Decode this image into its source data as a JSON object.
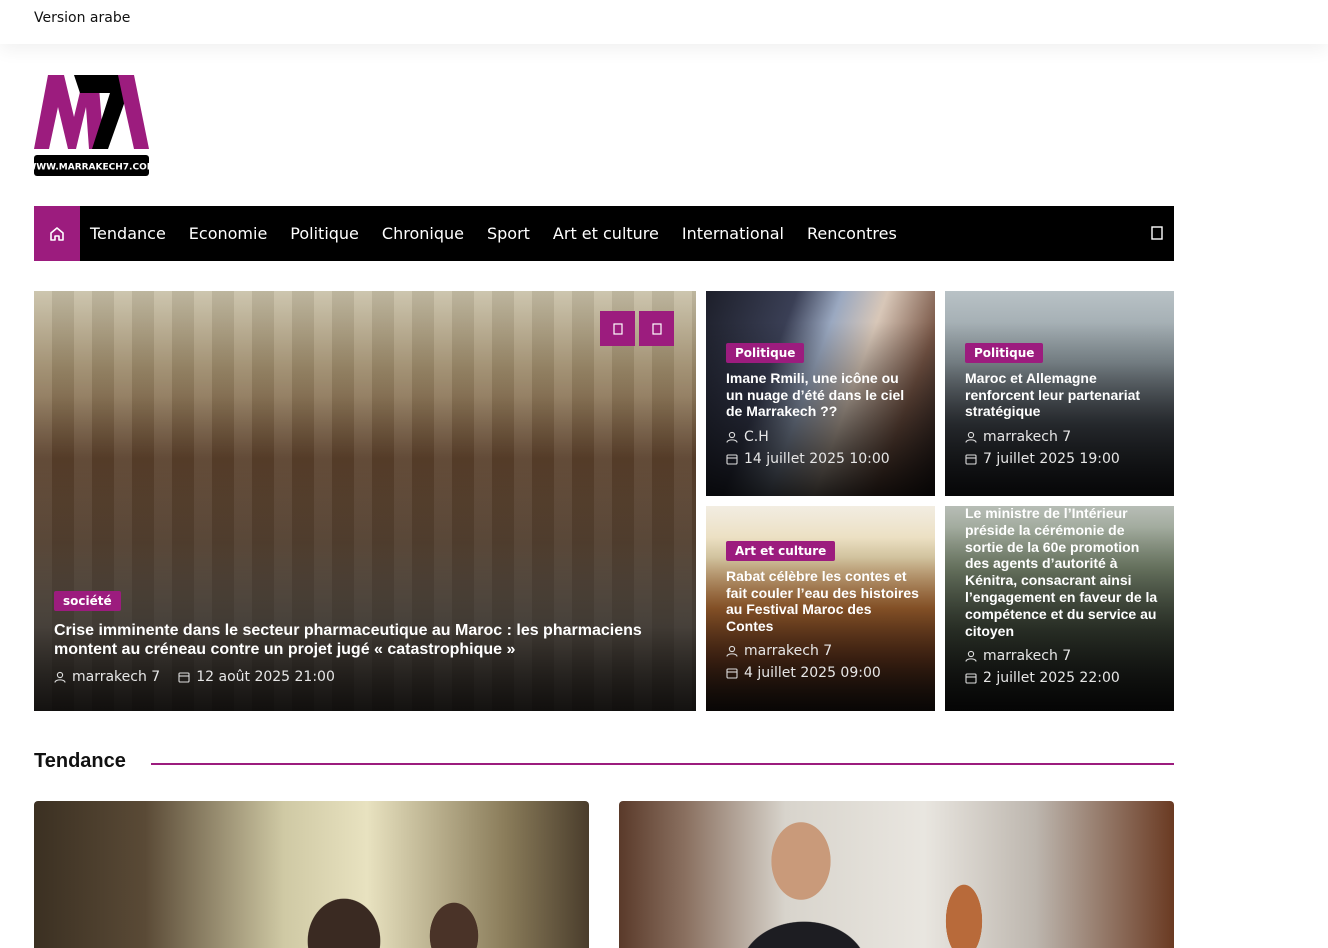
{
  "topbar": {
    "version_link": "Version arabe"
  },
  "logo": {
    "letters": "M7",
    "site": "WWW.MARRAKECH7.COM"
  },
  "nav": {
    "home_icon": "home-icon",
    "items": [
      "Tendance",
      "Economie",
      "Politique",
      "Chronique",
      "Sport",
      "Art et culture",
      "International",
      "Rencontres"
    ],
    "search_icon": "search-icon"
  },
  "colors": {
    "accent": "#9c1c7e",
    "nav_bg": "#000000"
  },
  "featured": {
    "category": "société",
    "title": "Crise imminente dans le secteur pharmaceutique au Maroc : les pharmaciens montent au créneau contre un projet jugé « catastrophique »",
    "author": "marrakech 7",
    "date": "12 août 2025 21:00",
    "prev_icon": "chevron-left-icon",
    "next_icon": "chevron-right-icon"
  },
  "side_cards": [
    {
      "category": "Politique",
      "title": "Imane Rmili, une icône ou un nuage d’été dans le ciel de Marrakech ??",
      "author": "C.H",
      "date": "14 juillet 2025 10:00"
    },
    {
      "category": "Politique",
      "title": "Maroc et Allemagne renforcent leur partenariat stratégique",
      "author": "marrakech 7",
      "date": "7 juillet 2025 19:00"
    },
    {
      "category": "Art et culture",
      "title": "Rabat célèbre les contes et fait couler l’eau des histoires au Festival Maroc des Contes",
      "author": "marrakech 7",
      "date": "4 juillet 2025 09:00"
    },
    {
      "category": "",
      "title": "Le ministre de l’Intérieur préside la cérémonie de sortie de la 60e promotion des agents d’autorité à Kénitra, consacrant ainsi l’engagement en faveur de la compétence et du service au citoyen",
      "author": "marrakech 7",
      "date": "2 juillet 2025 22:00"
    }
  ],
  "section": {
    "title": "Tendance"
  }
}
